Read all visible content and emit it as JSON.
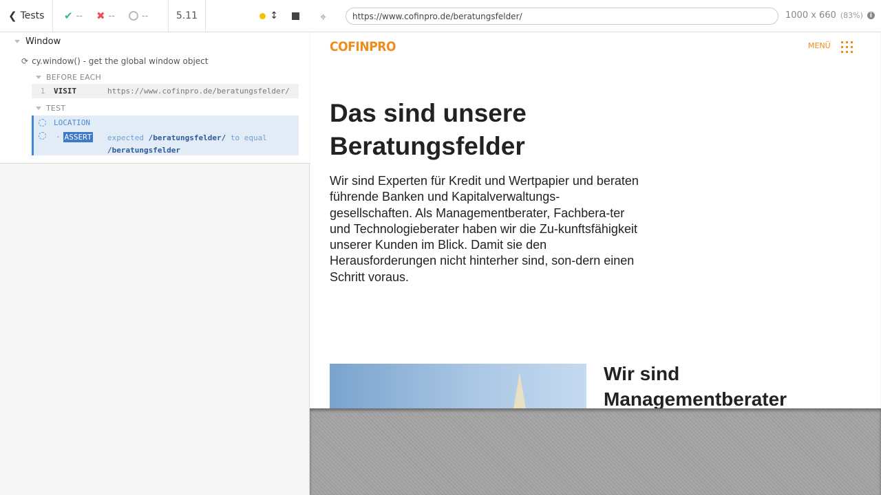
{
  "reporter": {
    "tests_label": "Tests",
    "stats": {
      "passed": "--",
      "failed": "--",
      "pending": "--"
    },
    "duration": "5.11",
    "suite_title": "Window",
    "test_title": "cy.window() - get the global window object",
    "hooks": {
      "before_each": "BEFORE EACH",
      "test": "TEST"
    },
    "commands": {
      "visit": {
        "number": "1",
        "name": "VISIT",
        "message": "https://www.cofinpro.de/beratungsfelder/"
      },
      "location": {
        "name": "LOCATION"
      },
      "assert": {
        "dash": "-",
        "name": "ASSERT",
        "expected_word": "expected",
        "actual": "/beratungsfelder/",
        "to_equal": "to equal",
        "expected": "/beratungsfelder"
      }
    }
  },
  "aut": {
    "url": "https://www.cofinpro.de/beratungsfelder/",
    "viewport": "1000 x 660",
    "scale": "(83%)"
  },
  "site": {
    "logo": "COFINPRO",
    "menu_label": "MENÜ",
    "hero_title": "Das sind unsere Beratungsfelder",
    "hero_text": "Wir sind Experten für Kredit und Wertpapier und beraten führende Banken und Kapitalverwaltungs-gesellschaften. Als Managementberater, Fachbera-ter und Technologieberater haben wir die Zu-kunftsfähigkeit unserer Kunden im Blick. Damit sie den Herausforderungen nicht hinterher sind, son-dern einen Schritt voraus.",
    "section_title": "Wir sind Managementberater"
  },
  "colors": {
    "brand_orange": "#f08b1e",
    "pass_green": "#3eb883",
    "fail_red": "#e94f5f",
    "active_blue": "#3f89d2"
  }
}
